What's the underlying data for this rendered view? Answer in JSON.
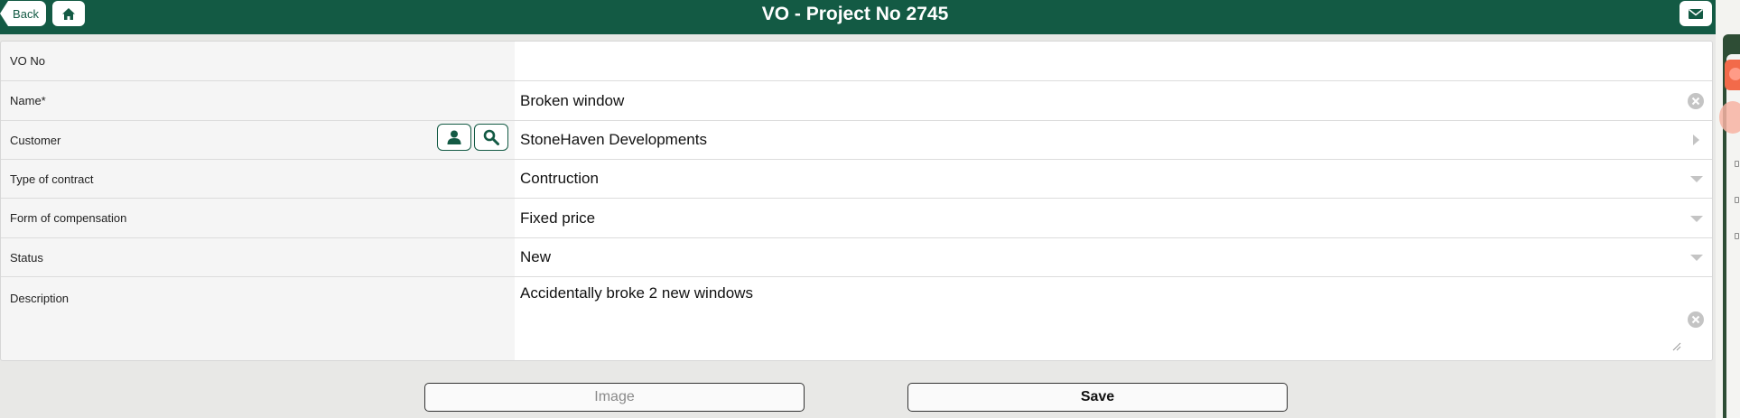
{
  "header": {
    "title": "VO - Project No 2745",
    "back_label": "Back",
    "home_icon": "home-icon",
    "mail_icon": "mail-icon",
    "bg_color": "#135a44"
  },
  "form": {
    "fields": [
      {
        "key": "vo_no",
        "label": "VO No",
        "value": ""
      },
      {
        "key": "name",
        "label": "Name*",
        "value": "Broken window",
        "control": "clear-icon"
      },
      {
        "key": "customer",
        "label": "Customer",
        "value": "StoneHaven Developments",
        "control": "chevron-right-icon",
        "buttons": [
          "person-icon",
          "search-icon"
        ]
      },
      {
        "key": "type_of_contract",
        "label": "Type of contract",
        "value": "Contruction",
        "control": "dropdown-icon"
      },
      {
        "key": "form_of_compensation",
        "label": "Form of compensation",
        "value": "Fixed price",
        "control": "dropdown-icon"
      },
      {
        "key": "status",
        "label": "Status",
        "value": "New",
        "control": "dropdown-icon"
      },
      {
        "key": "description",
        "label": "Description",
        "value": "Accidentally broke 2 new windows",
        "control": "clear-icon"
      }
    ]
  },
  "actions": {
    "image_label": "Image",
    "save_label": "Save"
  }
}
